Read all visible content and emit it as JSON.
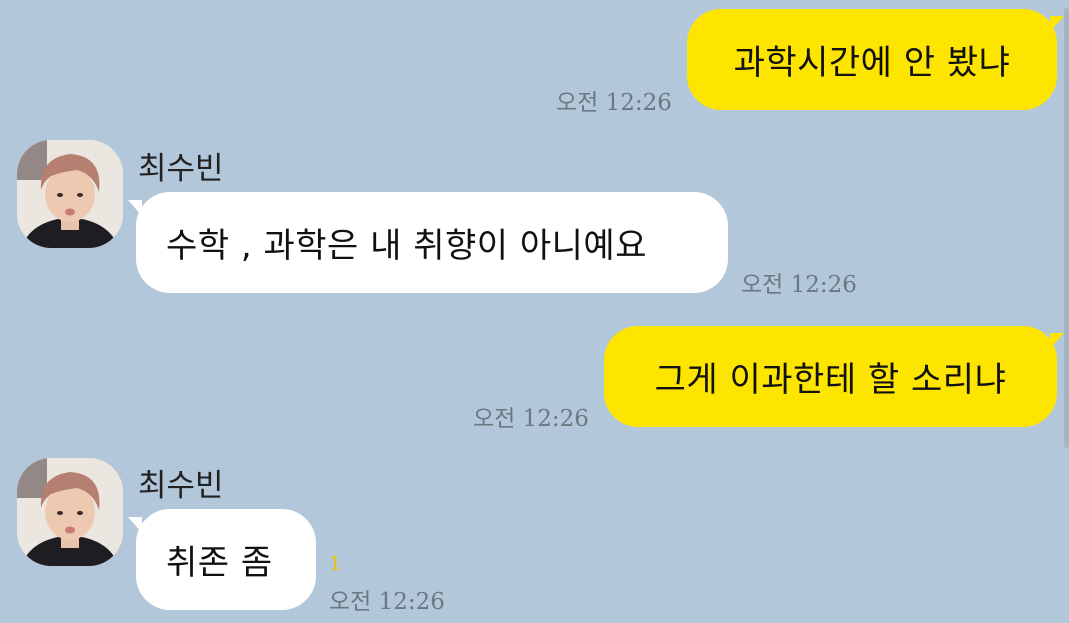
{
  "messages": [
    {
      "id": 1,
      "from": "me",
      "text": "과학시간에 안 봤냐",
      "time": "오전 12:26"
    },
    {
      "id": 2,
      "from": "other",
      "sender": "최수빈",
      "text": "수학 , 과학은 내 취향이 아니예요",
      "time": "오전 12:26"
    },
    {
      "id": 3,
      "from": "me",
      "text": "그게 이과한테 할 소리냐",
      "time": "오전 12:26"
    },
    {
      "id": 4,
      "from": "other",
      "sender": "최수빈",
      "text": "취존 좀",
      "time": "오전 12:26",
      "unread": "1"
    }
  ],
  "colors": {
    "background": "#b2c7da",
    "my_bubble": "#fee500",
    "other_bubble": "#ffffff",
    "time_text": "#6d7780",
    "unread_count": "#e8c500"
  },
  "icons": {
    "avatar": "profile-photo"
  }
}
